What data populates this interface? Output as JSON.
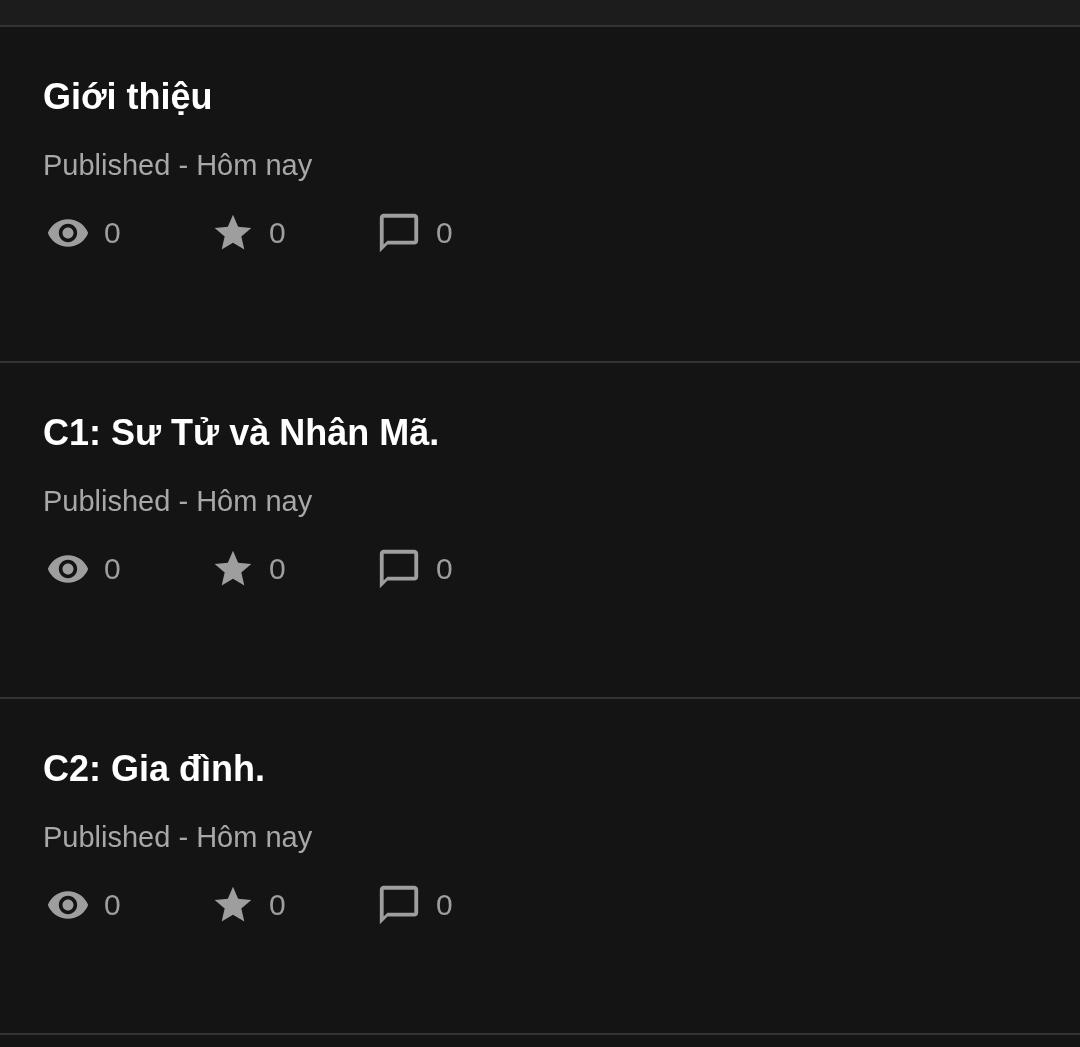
{
  "parts": [
    {
      "title": "Giới thiệu",
      "subtitle": "Published - Hôm nay",
      "views": "0",
      "votes": "0",
      "comments": "0"
    },
    {
      "title": "C1: Sư Tử và Nhân Mã.",
      "subtitle": "Published - Hôm nay",
      "views": "0",
      "votes": "0",
      "comments": "0"
    },
    {
      "title": "C2: Gia đình.",
      "subtitle": "Published - Hôm nay",
      "views": "0",
      "votes": "0",
      "comments": "0"
    }
  ]
}
